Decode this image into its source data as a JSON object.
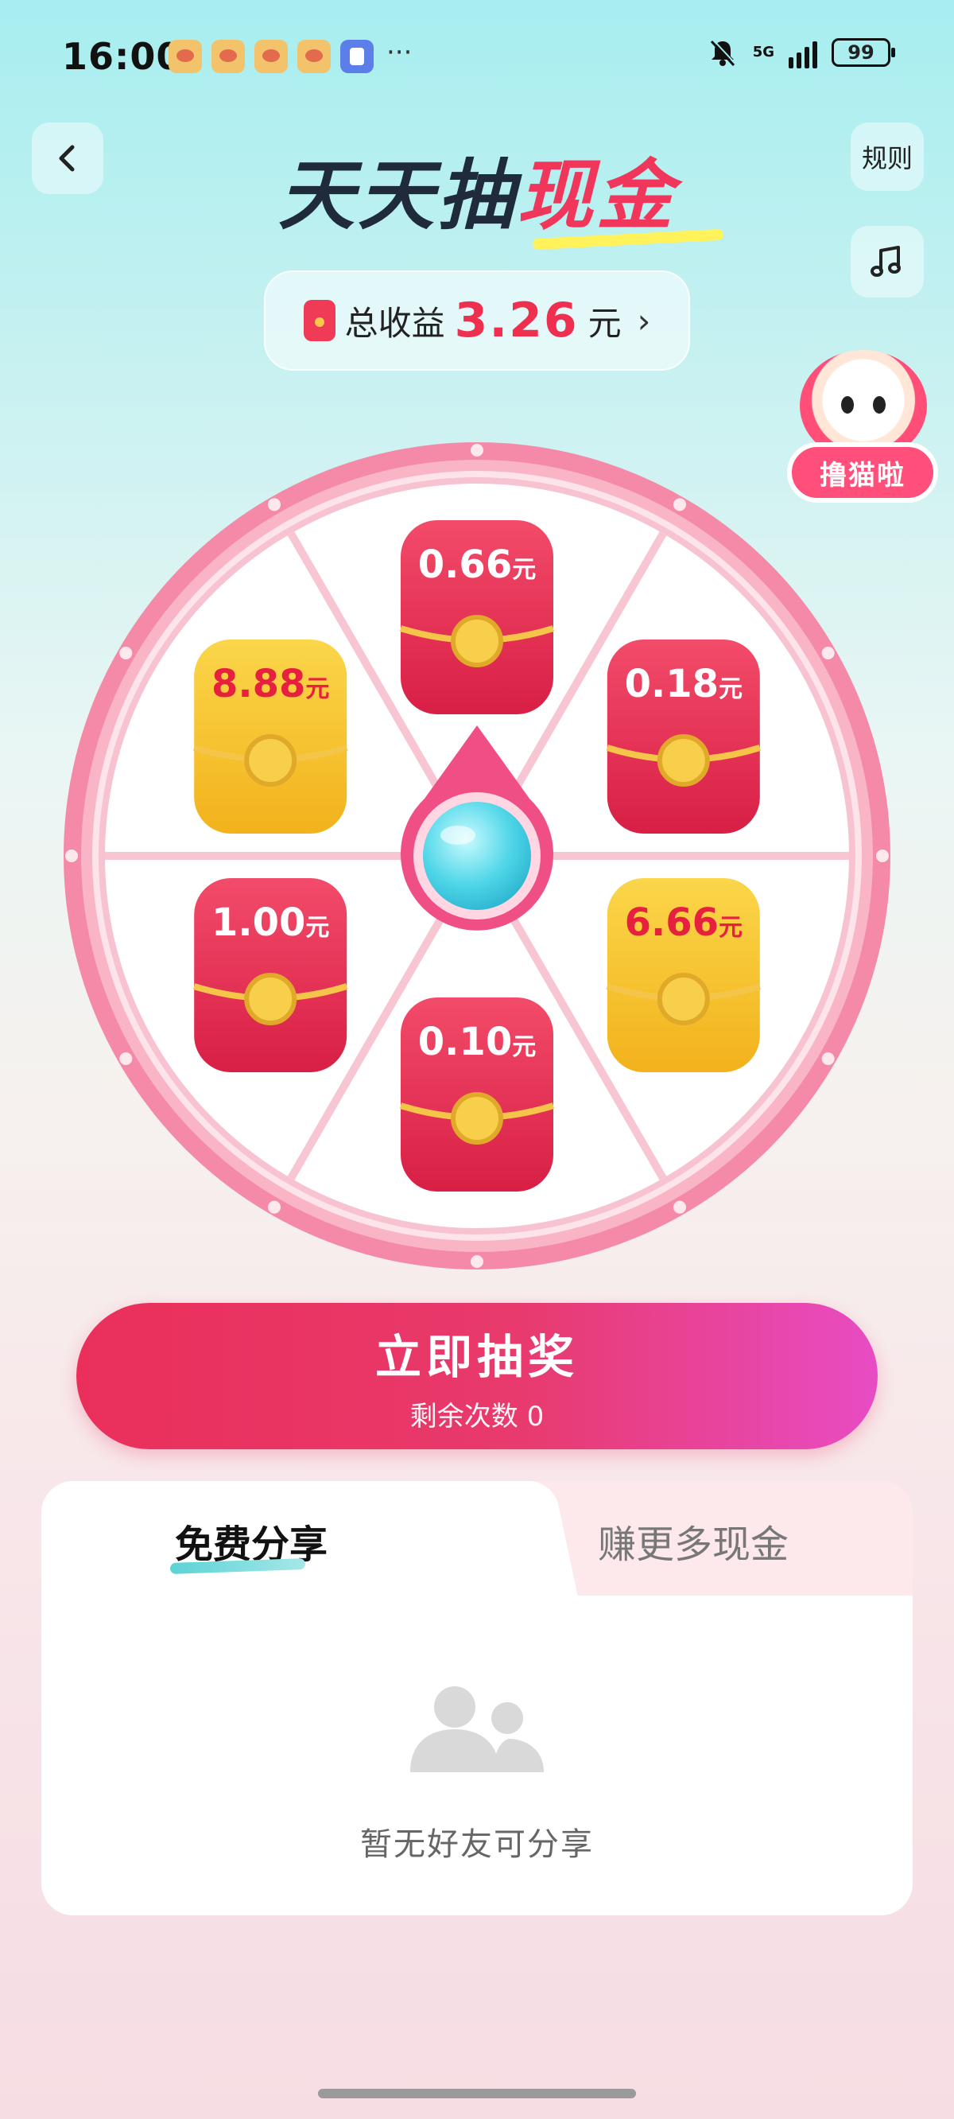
{
  "status_bar": {
    "time": "16:00",
    "more": "···",
    "network": "5G",
    "battery": "99"
  },
  "header": {
    "title_part1": "天天抽",
    "title_part2": "现金",
    "rules_label": "规则"
  },
  "earnings": {
    "label": "总收益",
    "value": "3.26",
    "unit": "元",
    "chevron": "›"
  },
  "mascot": {
    "label": "撸猫啦"
  },
  "wheel": {
    "prizes": [
      {
        "amount": "0.66",
        "unit": "元",
        "color": "red"
      },
      {
        "amount": "0.18",
        "unit": "元",
        "color": "red"
      },
      {
        "amount": "6.66",
        "unit": "元",
        "color": "gold"
      },
      {
        "amount": "0.10",
        "unit": "元",
        "color": "red"
      },
      {
        "amount": "1.00",
        "unit": "元",
        "color": "red"
      },
      {
        "amount": "8.88",
        "unit": "元",
        "color": "gold"
      }
    ]
  },
  "draw": {
    "label": "立即抽奖",
    "remaining": "剩余次数 0"
  },
  "tabs": {
    "free_share": "免费分享",
    "earn_more": "赚更多现金"
  },
  "empty_state": {
    "text": "暂无好友可分享"
  },
  "colors": {
    "accent": "#ee2f4f",
    "button_gradient_start": "#ea2f5b",
    "button_gradient_end": "#e84cc4",
    "wheel_rim": "#f58aa8",
    "gold": "#f6c12e",
    "teal": "#5bd3d6"
  },
  "icons": {
    "back": "chevron-left-icon",
    "music": "music-note-icon",
    "empty": "people-icon",
    "muted": "bell-off-icon"
  }
}
